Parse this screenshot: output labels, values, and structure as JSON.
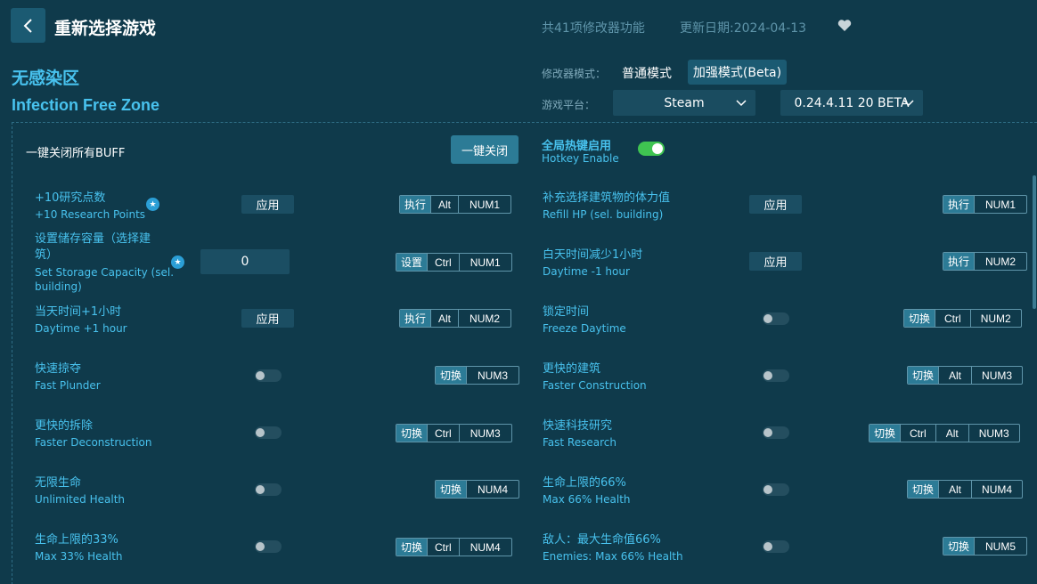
{
  "header": {
    "title": "重新选择游戏",
    "feature_count": "共41项修改器功能",
    "update_date": "更新日期:2024-04-13"
  },
  "game": {
    "name_cn": "无感染区",
    "name_en": "Infection Free Zone"
  },
  "mode": {
    "label": "修改器模式：",
    "normal": "普通模式",
    "beta": "加强模式(Beta)"
  },
  "platform": {
    "label": "游戏平台：",
    "selected": "Steam",
    "version": "0.24.4.11 20 BETA"
  },
  "global": {
    "buff_label": "一键关闭所有BUFF",
    "close_all": "一键关闭",
    "hotkey_cn": "全局热键启用",
    "hotkey_en": "Hotkey Enable"
  },
  "common": {
    "apply": "应用",
    "input_value": "0"
  },
  "features": [
    {
      "cn": "+10研究点数",
      "en": "+10 Research Points",
      "action": "执行",
      "keys": [
        "Alt",
        "NUM1"
      ]
    },
    {
      "cn": "设置储存容量（选择建",
      "cn2": "筑）",
      "en": "Set Storage Capacity (sel.",
      "en2": "building)",
      "action": "设置",
      "keys": [
        "Ctrl",
        "NUM1"
      ]
    },
    {
      "cn": "当天时间+1小时",
      "en": "Daytime +1 hour",
      "action": "执行",
      "keys": [
        "Alt",
        "NUM2"
      ]
    },
    {
      "cn": "快速掠夺",
      "en": "Fast Plunder",
      "action": "切换",
      "keys": [
        "NUM3"
      ]
    },
    {
      "cn": "更快的拆除",
      "en": "Faster Deconstruction",
      "action": "切换",
      "keys": [
        "Ctrl",
        "NUM3"
      ]
    },
    {
      "cn": "无限生命",
      "en": "Unlimited Health",
      "action": "切换",
      "keys": [
        "NUM4"
      ]
    },
    {
      "cn": "生命上限的33%",
      "en": "Max 33% Health",
      "action": "切换",
      "keys": [
        "Ctrl",
        "NUM4"
      ]
    },
    {
      "cn": "补充选择建筑物的体力值",
      "en": "Refill HP (sel. building)",
      "action": "执行",
      "keys": [
        "NUM1"
      ]
    },
    {
      "cn": "白天时间减少1小时",
      "en": "Daytime -1 hour",
      "action": "执行",
      "keys": [
        "NUM2"
      ]
    },
    {
      "cn": "锁定时间",
      "en": "Freeze Daytime",
      "action": "切换",
      "keys": [
        "Ctrl",
        "NUM2"
      ]
    },
    {
      "cn": "更快的建筑",
      "en": "Faster Construction",
      "action": "切换",
      "keys": [
        "Alt",
        "NUM3"
      ]
    },
    {
      "cn": "快速科技研究",
      "en": "Fast Research",
      "action": "切换",
      "keys": [
        "Ctrl",
        "Alt",
        "NUM3"
      ]
    },
    {
      "cn": "生命上限的66%",
      "en": "Max 66% Health",
      "action": "切换",
      "keys": [
        "Alt",
        "NUM4"
      ]
    },
    {
      "cn": "敌人：最大生命值66%",
      "en": "Enemies: Max 66% Health",
      "action": "切换",
      "keys": [
        "NUM5"
      ]
    }
  ]
}
